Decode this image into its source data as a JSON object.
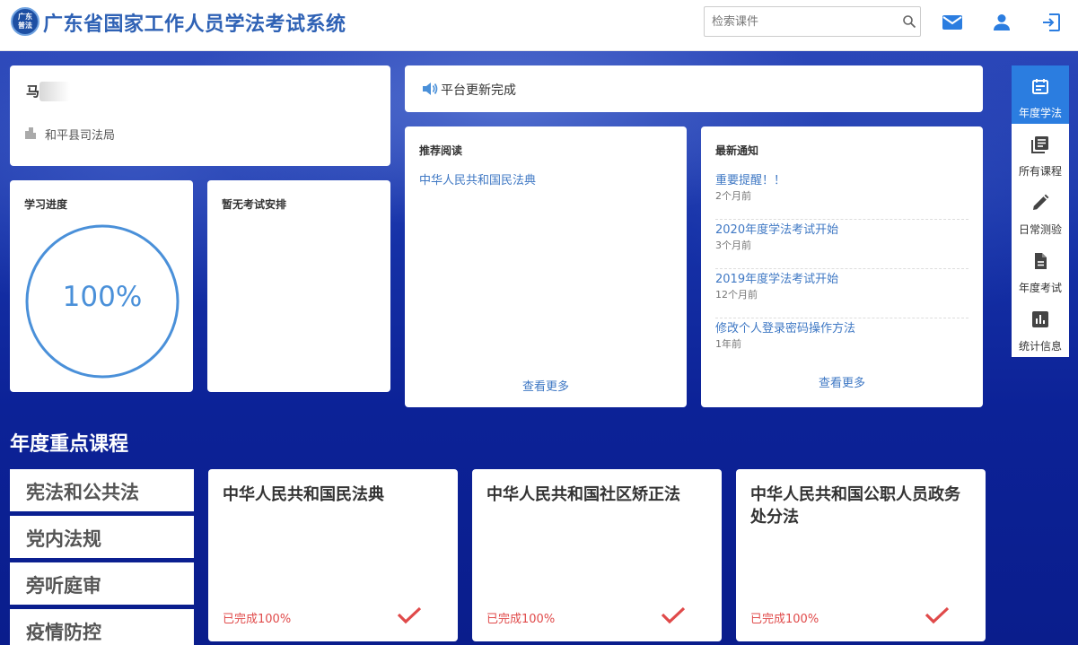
{
  "header": {
    "logo_text": "广东普法",
    "site_title": "广东省国家工作人员学法考试系统",
    "search_placeholder": "检索课件",
    "icons": [
      "mail-icon",
      "user-icon",
      "logout-icon"
    ]
  },
  "user": {
    "name": "马",
    "org": "和平县司法局"
  },
  "progress": {
    "title": "学习进度",
    "percent_text": "100%",
    "percent": 100
  },
  "exam": {
    "title": "暂无考试安排"
  },
  "announcement": {
    "text": "平台更新完成"
  },
  "reading": {
    "title": "推荐阅读",
    "items": [
      "中华人民共和国民法典"
    ],
    "more": "查看更多"
  },
  "notices": {
    "title": "最新通知",
    "items": [
      {
        "title": "重要提醒！！",
        "time": "2个月前"
      },
      {
        "title": "2020年度学法考试开始",
        "time": "3个月前"
      },
      {
        "title": "2019年度学法考试开始",
        "time": "12个月前"
      },
      {
        "title": "修改个人登录密码操作方法",
        "time": "1年前"
      }
    ],
    "more": "查看更多"
  },
  "sidenav": {
    "items": [
      {
        "label": "年度学法",
        "icon": "calendar-icon",
        "active": true
      },
      {
        "label": "所有课程",
        "icon": "library-icon",
        "active": false
      },
      {
        "label": "日常测验",
        "icon": "pencil-icon",
        "active": false
      },
      {
        "label": "年度考试",
        "icon": "document-icon",
        "active": false
      },
      {
        "label": "统计信息",
        "icon": "bar-chart-icon",
        "active": false
      }
    ]
  },
  "section": {
    "title": "年度重点课程",
    "categories": [
      "宪法和公共法",
      "党内法规",
      "旁听庭审",
      "疫情防控"
    ],
    "courses": [
      {
        "title": "中华人民共和国民法典",
        "status": "已完成100%"
      },
      {
        "title": "中华人民共和国社区矫正法",
        "status": "已完成100%"
      },
      {
        "title": "中华人民共和国公职人员政务处分法",
        "status": "已完成100%"
      }
    ]
  },
  "colors": {
    "accent": "#2b7de0",
    "link": "#3f78c4",
    "progress": "#4a90d9",
    "complete": "#e04a4a",
    "background": "#0a1f8f"
  }
}
